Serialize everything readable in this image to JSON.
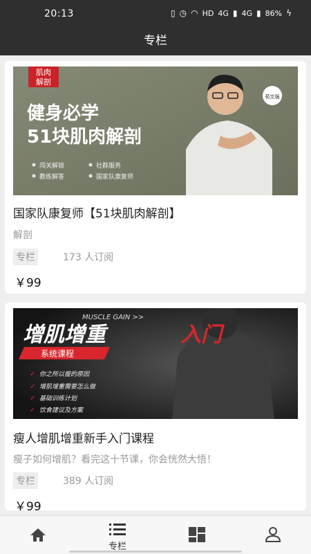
{
  "status": {
    "time": "20:13",
    "network": "HD",
    "signal1": "4G",
    "signal2": "4G",
    "battery": "86%"
  },
  "header": {
    "title": "专栏"
  },
  "cards": [
    {
      "title": "国家队康复师【51块肌肉解剖】",
      "description": "解剖",
      "tag": "专栏",
      "subscribers": "173 人订阅",
      "price": "￥99",
      "banner": {
        "badge_top": "肌肉",
        "badge_bottom": "解剖",
        "headline1": "健身必学",
        "headline2": "51块肌肉解剖",
        "side_badge": "荀文强",
        "features": [
          "闯关解锁",
          "社群服务",
          "教练解答",
          "国家队康复师"
        ]
      }
    },
    {
      "title": "瘦人增肌增重新手入门课程",
      "description": "瘦子如何增肌？看完这十节课，你会恍然大悟！",
      "tag": "专栏",
      "subscribers": "389 人订阅",
      "price": "￥99",
      "banner": {
        "kicker": "MUSCLE GAIN >>",
        "headline_white": "增肌增重",
        "headline_red": "入门",
        "ribbon": "系统课程",
        "bullets": [
          "你之所以瘦的原因",
          "增肌增重需要怎么做",
          "基础训练计划",
          "饮食建议及方案"
        ]
      }
    }
  ],
  "tabbar": {
    "column_label": "专栏"
  },
  "colors": {
    "dark_bar": "#2f2f2f",
    "accent_red": "#d9262c",
    "banner1_bg": "#7a7f6b"
  }
}
